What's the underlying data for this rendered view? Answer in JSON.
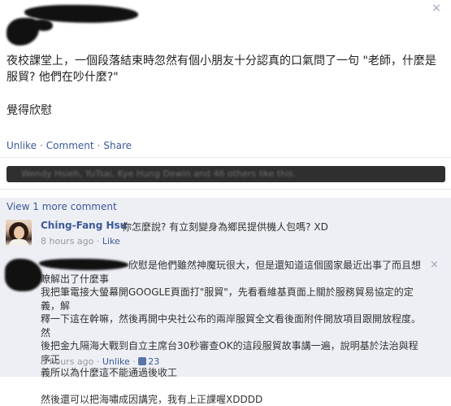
{
  "post": {
    "body_line1": "夜校課堂上，一個段落結束時忽然有個小朋友十分認真的口氣問了一句 \"老師，什麼是",
    "body_line2": "服貿? 他們在吵什麼?\"",
    "sign": "覺得欣慰",
    "actions": {
      "unlike": "Unlike",
      "comment": "Comment",
      "share": "Share",
      "sep": "·"
    },
    "close_glyph": "×"
  },
  "likes": {
    "text": "Wendy Hsieh, YuTsai, Kye Hung Dewin and 46 others like this."
  },
  "more_comments": {
    "label": "View 1 more comment"
  },
  "comment1": {
    "author": "Ching-Fang Hsu",
    "text": "你怎麼說? 有立刻變身為鄉民提供機人包嗎?  XD",
    "time": "8 hours ago",
    "sep": "·",
    "like": "Like"
  },
  "comment2": {
    "lines": [
      "欣慰是他們雖然神魔玩很大，但是還知道這個國家最近出事了而且想",
      "瞭解出了什麼事",
      "我把筆電接大螢幕開GOOGLE頁面打\"服貿\"，先看看維基頁面上關於服務貿易協定的定義，解",
      "釋一下這在幹嘛，然後再開中央社公布的兩岸服貿全文看後面附件開放項目跟開放程度。然",
      "後把金九隔海大戰到自立主席台30秒審查OK的這段服貿故事講一遍，說明基於法治與程序正",
      "義所以為什麼這不能通過後收工",
      "",
      "然後還可以把海嘯成因講完，我有上正課喔XDDDD"
    ],
    "time": "8 hours ago",
    "sep": "·",
    "unlike": "Unlike",
    "like_count": "23",
    "close_glyph": "×"
  }
}
